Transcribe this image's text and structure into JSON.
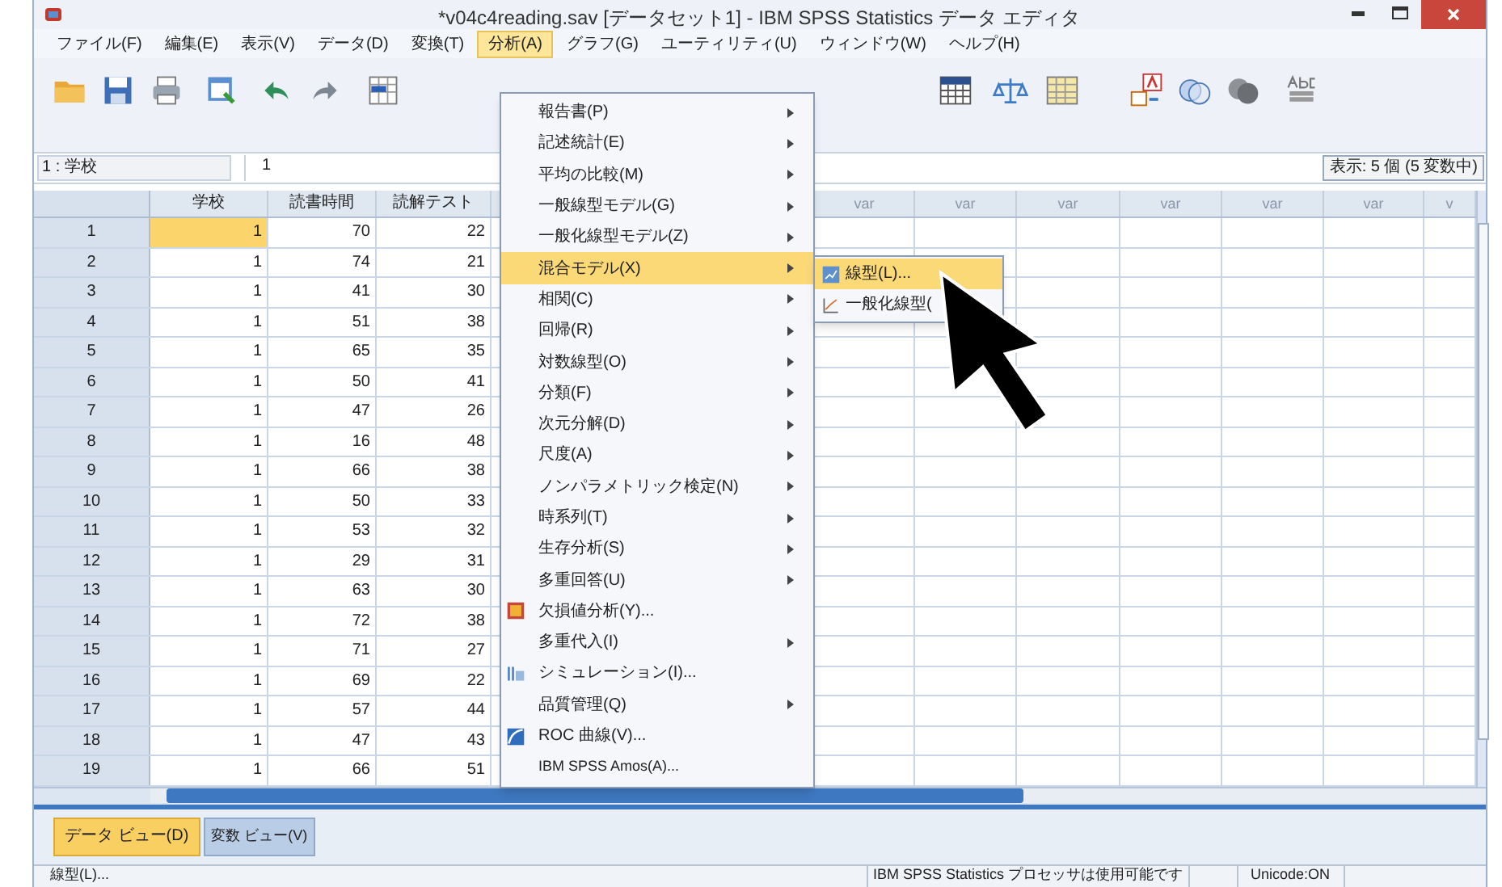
{
  "window": {
    "title": "*v04c4reading.sav [データセット1] - IBM SPSS Statistics データ エディタ"
  },
  "menu_bar": [
    {
      "label": "ファイル(F)",
      "selected": false
    },
    {
      "label": "編集(E)",
      "selected": false
    },
    {
      "label": "表示(V)",
      "selected": false
    },
    {
      "label": "データ(D)",
      "selected": false
    },
    {
      "label": "変換(T)",
      "selected": false
    },
    {
      "label": "分析(A)",
      "selected": true
    },
    {
      "label": "グラフ(G)",
      "selected": false
    },
    {
      "label": "ユーティリティ(U)",
      "selected": false
    },
    {
      "label": "ウィンドウ(W)",
      "selected": false
    },
    {
      "label": "ヘルプ(H)",
      "selected": false
    }
  ],
  "cell_editor": {
    "cell": "1 : 学校",
    "value": "1",
    "visible_count": "表示: 5 個 (5 変数中)"
  },
  "grid": {
    "columns": [
      "学校",
      "読書時間",
      "読解テスト"
    ],
    "var_columns": [
      "var",
      "var",
      "var",
      "var",
      "var",
      "var",
      "v"
    ],
    "rows": [
      {
        "number": "1",
        "cells": [
          "1",
          "70",
          "22"
        ],
        "selected": true
      },
      {
        "number": "2",
        "cells": [
          "1",
          "74",
          "21"
        ],
        "selected": false
      },
      {
        "number": "3",
        "cells": [
          "1",
          "41",
          "30"
        ],
        "selected": false
      },
      {
        "number": "4",
        "cells": [
          "1",
          "51",
          "38"
        ],
        "selected": false
      },
      {
        "number": "5",
        "cells": [
          "1",
          "65",
          "35"
        ],
        "selected": false
      },
      {
        "number": "6",
        "cells": [
          "1",
          "50",
          "41"
        ],
        "selected": false
      },
      {
        "number": "7",
        "cells": [
          "1",
          "47",
          "26"
        ],
        "selected": false
      },
      {
        "number": "8",
        "cells": [
          "1",
          "16",
          "48"
        ],
        "selected": false
      },
      {
        "number": "9",
        "cells": [
          "1",
          "66",
          "38"
        ],
        "selected": false
      },
      {
        "number": "10",
        "cells": [
          "1",
          "50",
          "33"
        ],
        "selected": false
      },
      {
        "number": "11",
        "cells": [
          "1",
          "53",
          "32"
        ],
        "selected": false
      },
      {
        "number": "12",
        "cells": [
          "1",
          "29",
          "31"
        ],
        "selected": false
      },
      {
        "number": "13",
        "cells": [
          "1",
          "63",
          "30"
        ],
        "selected": false
      },
      {
        "number": "14",
        "cells": [
          "1",
          "72",
          "38"
        ],
        "selected": false
      },
      {
        "number": "15",
        "cells": [
          "1",
          "71",
          "27"
        ],
        "selected": false
      },
      {
        "number": "16",
        "cells": [
          "1",
          "69",
          "22"
        ],
        "selected": false
      },
      {
        "number": "17",
        "cells": [
          "1",
          "57",
          "44"
        ],
        "selected": false
      },
      {
        "number": "18",
        "cells": [
          "1",
          "47",
          "43"
        ],
        "selected": false
      },
      {
        "number": "19",
        "cells": [
          "1",
          "66",
          "51"
        ],
        "selected": false
      }
    ]
  },
  "analyze_menu": [
    {
      "label": "報告書(P)",
      "kind": "submenu",
      "selected": false
    },
    {
      "label": "記述統計(E)",
      "kind": "submenu",
      "selected": false
    },
    {
      "label": "平均の比較(M)",
      "kind": "submenu",
      "selected": false
    },
    {
      "label": "一般線型モデル(G)",
      "kind": "submenu",
      "selected": false
    },
    {
      "label": "一般化線型モデル(Z)",
      "kind": "submenu",
      "selected": false
    },
    {
      "label": "混合モデル(X)",
      "kind": "submenu",
      "selected": true
    },
    {
      "label": "相関(C)",
      "kind": "submenu",
      "selected": false
    },
    {
      "label": "回帰(R)",
      "kind": "submenu",
      "selected": false
    },
    {
      "label": "対数線型(O)",
      "kind": "submenu",
      "selected": false
    },
    {
      "label": "分類(F)",
      "kind": "submenu",
      "selected": false
    },
    {
      "label": "次元分解(D)",
      "kind": "submenu",
      "selected": false
    },
    {
      "label": "尺度(A)",
      "kind": "submenu",
      "selected": false
    },
    {
      "label": "ノンパラメトリック検定(N)",
      "kind": "submenu",
      "selected": false
    },
    {
      "label": "時系列(T)",
      "kind": "submenu",
      "selected": false
    },
    {
      "label": "生存分析(S)",
      "kind": "submenu",
      "selected": false
    },
    {
      "label": "多重回答(U)",
      "kind": "submenu",
      "selected": false
    },
    {
      "label": "欠損値分析(Y)...",
      "kind": "missing",
      "selected": false
    },
    {
      "label": "多重代入(I)",
      "kind": "submenu",
      "selected": false
    },
    {
      "label": "シミュレーション(I)...",
      "kind": "simulation",
      "selected": false
    },
    {
      "label": "品質管理(Q)",
      "kind": "submenu",
      "selected": false
    },
    {
      "label": "ROC 曲線(V)...",
      "kind": "roc",
      "selected": false
    },
    {
      "label": "IBM SPSS Amos(A)...",
      "kind": "plain",
      "selected": false
    }
  ],
  "mixed_models_submenu": [
    {
      "label": "線型(L)...",
      "kind": "linear",
      "selected": true
    },
    {
      "label": "一般化線型(",
      "kind": "generalized",
      "selected": false
    }
  ],
  "view_tabs": [
    {
      "label": "データ ビュー(D)",
      "selected": true
    },
    {
      "label": "変数 ビュー(V)",
      "selected": false
    }
  ],
  "status_bar": {
    "message": "線型(L)...",
    "processor": "IBM SPSS Statistics プロセッサは使用可能です",
    "unicode": "Unicode:ON"
  }
}
